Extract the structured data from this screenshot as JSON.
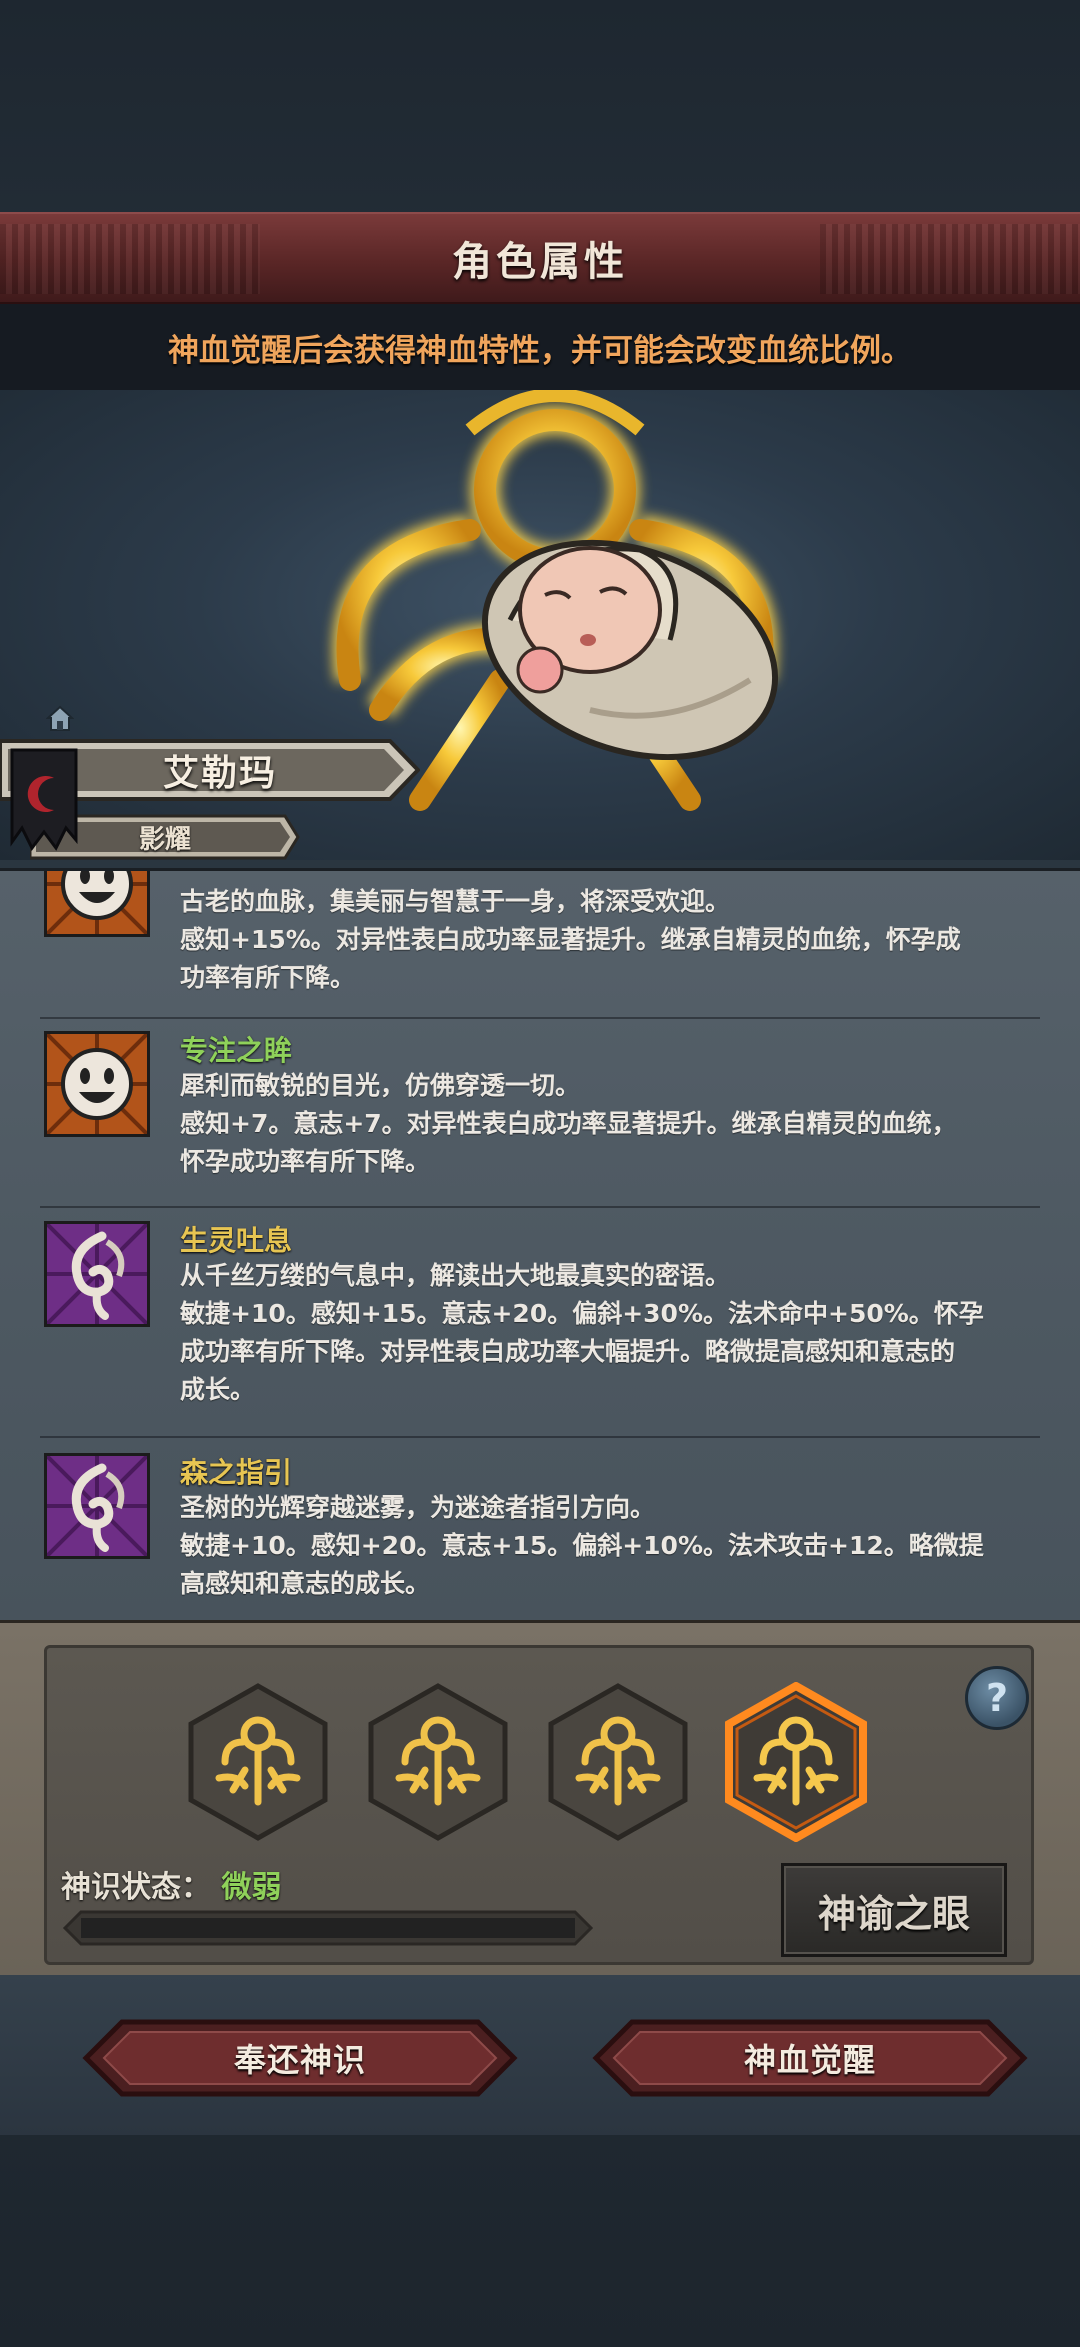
{
  "header": {
    "title": "角色属性",
    "hint": "神血觉醒后会获得神血特性，并可能会改变血统比例。"
  },
  "character": {
    "name": "艾勒玛",
    "subtitle": "影耀"
  },
  "traits": [
    {
      "name": "",
      "name_color": "green",
      "icon": "smiley-face-icon",
      "lines": [
        "古老的血脉，集美丽与智慧于一身，将深受欢迎。",
        "感知+15%。对异性表白成功率显著提升。继承自精灵的血统，怀孕成",
        "功率有所下降。"
      ]
    },
    {
      "name": "专注之眸",
      "name_color": "green",
      "icon": "smiley-face-icon",
      "lines": [
        "犀利而敏锐的目光，仿佛穿透一切。",
        "感知+7。意志+7。对异性表白成功率显著提升。继承自精灵的血统，",
        "怀孕成功率有所下降。"
      ]
    },
    {
      "name": "生灵吐息",
      "name_color": "yellow",
      "icon": "spirit-swirl-icon",
      "lines": [
        "从千丝万缕的气息中，解读出大地最真实的密语。",
        "敏捷+10。感知+15。意志+20。偏斜+30%。法术命中+50%。怀孕",
        "成功率有所下降。对异性表白成功率大幅提升。略微提高感知和意志的",
        "成长。"
      ]
    },
    {
      "name": "森之指引",
      "name_color": "yellow",
      "icon": "spirit-swirl-icon",
      "lines": [
        "圣树的光辉穿越迷雾，为迷途者指引方向。",
        "敏捷+10。感知+20。意志+15。偏斜+10%。法术攻击+12。略微提",
        "高感知和意志的成长。"
      ]
    }
  ],
  "divine_panel": {
    "help_label": "?",
    "state_label": "神识状态：",
    "state_value": "微弱",
    "progress": 0.0,
    "oracle_button": "神谕之眼",
    "sigils_active_index": 3
  },
  "actions": {
    "return_button": "奉还神识",
    "awaken_button": "神血觉醒"
  },
  "colors": {
    "accent_orange": "#f0a55c",
    "trait_green": "#8fd15a",
    "trait_yellow": "#e7c552",
    "banner_red": "#6b2b2c"
  }
}
